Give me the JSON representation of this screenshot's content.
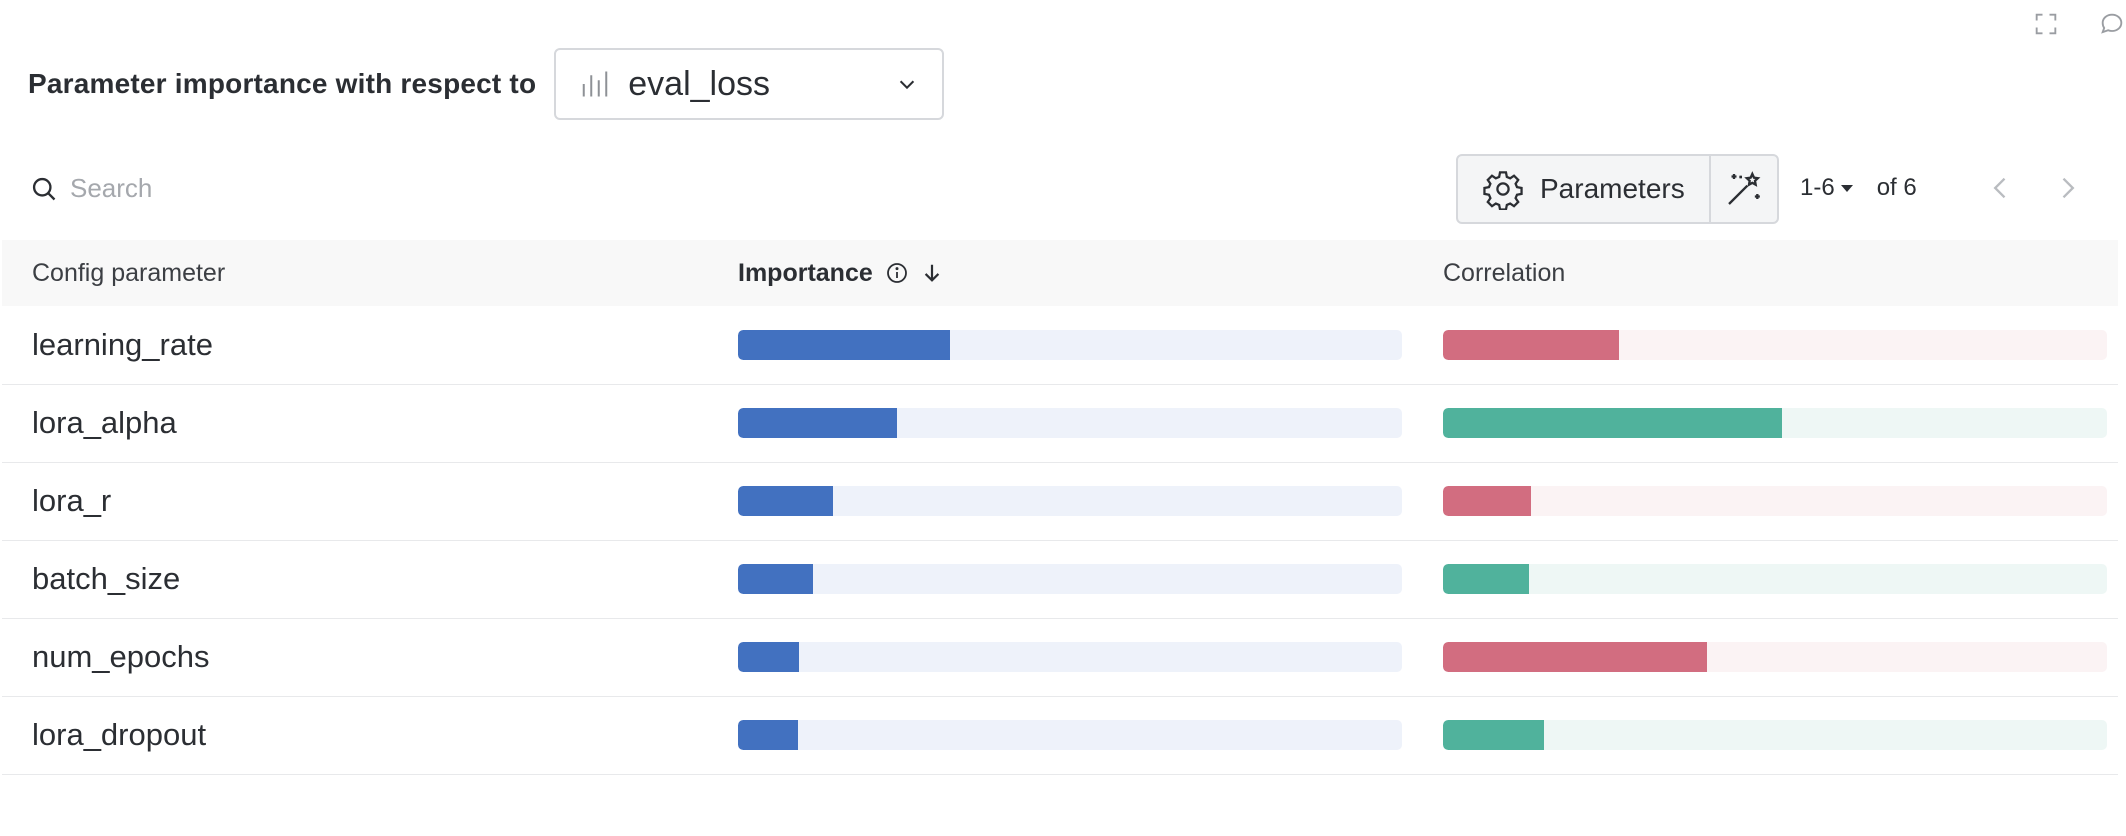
{
  "header": {
    "label": "Parameter importance with respect to",
    "metric": "eval_loss"
  },
  "toolbar": {
    "search_placeholder": "Search",
    "parameters_label": "Parameters",
    "page_range": "1-6",
    "page_total": "of 6"
  },
  "table": {
    "columns": {
      "param": "Config parameter",
      "importance": "Importance",
      "correlation": "Correlation"
    },
    "rows": [
      {
        "name": "learning_rate",
        "importance": 0.32,
        "correlation": 0.265,
        "correlation_sign": "negative"
      },
      {
        "name": "lora_alpha",
        "importance": 0.24,
        "correlation": 0.51,
        "correlation_sign": "positive"
      },
      {
        "name": "lora_r",
        "importance": 0.143,
        "correlation": 0.133,
        "correlation_sign": "negative"
      },
      {
        "name": "batch_size",
        "importance": 0.113,
        "correlation": 0.13,
        "correlation_sign": "positive"
      },
      {
        "name": "num_epochs",
        "importance": 0.092,
        "correlation": 0.398,
        "correlation_sign": "negative"
      },
      {
        "name": "lora_dropout",
        "importance": 0.09,
        "correlation": 0.152,
        "correlation_sign": "positive"
      }
    ]
  },
  "colors": {
    "importance": "#4271c0",
    "correlation_negative": "#d26d80",
    "correlation_positive": "#50b29c"
  }
}
